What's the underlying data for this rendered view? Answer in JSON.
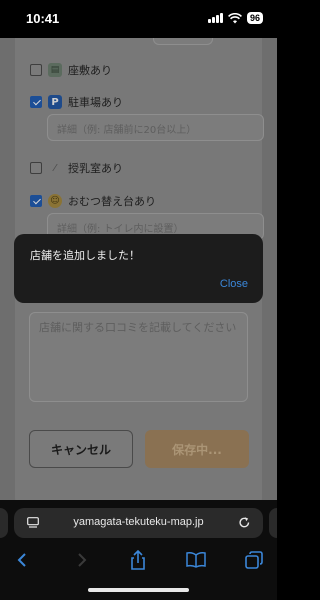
{
  "status_bar": {
    "time": "10:41",
    "battery": "96"
  },
  "form": {
    "options": [
      {
        "label": "座敷あり",
        "checked": false,
        "icon": "tatami-icon"
      },
      {
        "label": "駐車場あり",
        "checked": true,
        "icon": "parking-icon"
      },
      {
        "label": "授乳室あり",
        "checked": false,
        "icon": "baby-bottle-icon"
      },
      {
        "label": "おむつ替え台あり",
        "checked": true,
        "icon": "baby-face-icon"
      }
    ],
    "parking_detail_placeholder": "詳細（例: 店舗前に20台以上）",
    "diaper_detail_placeholder": "詳細（例: トイレ内に設置）",
    "review_placeholder": "店舗に関する口コミを記載してください",
    "cancel_label": "キャンセル",
    "save_label": "保存中..."
  },
  "toast": {
    "message": "店舗を追加しました！",
    "close_label": "Close"
  },
  "browser": {
    "url": "yamagata-tekuteku-map.jp"
  },
  "colors": {
    "toast_bg": "#1c1c1c",
    "toast_link": "#3b87d9",
    "save_button": "#8a7152",
    "checkbox_checked": "#1c4e96"
  }
}
